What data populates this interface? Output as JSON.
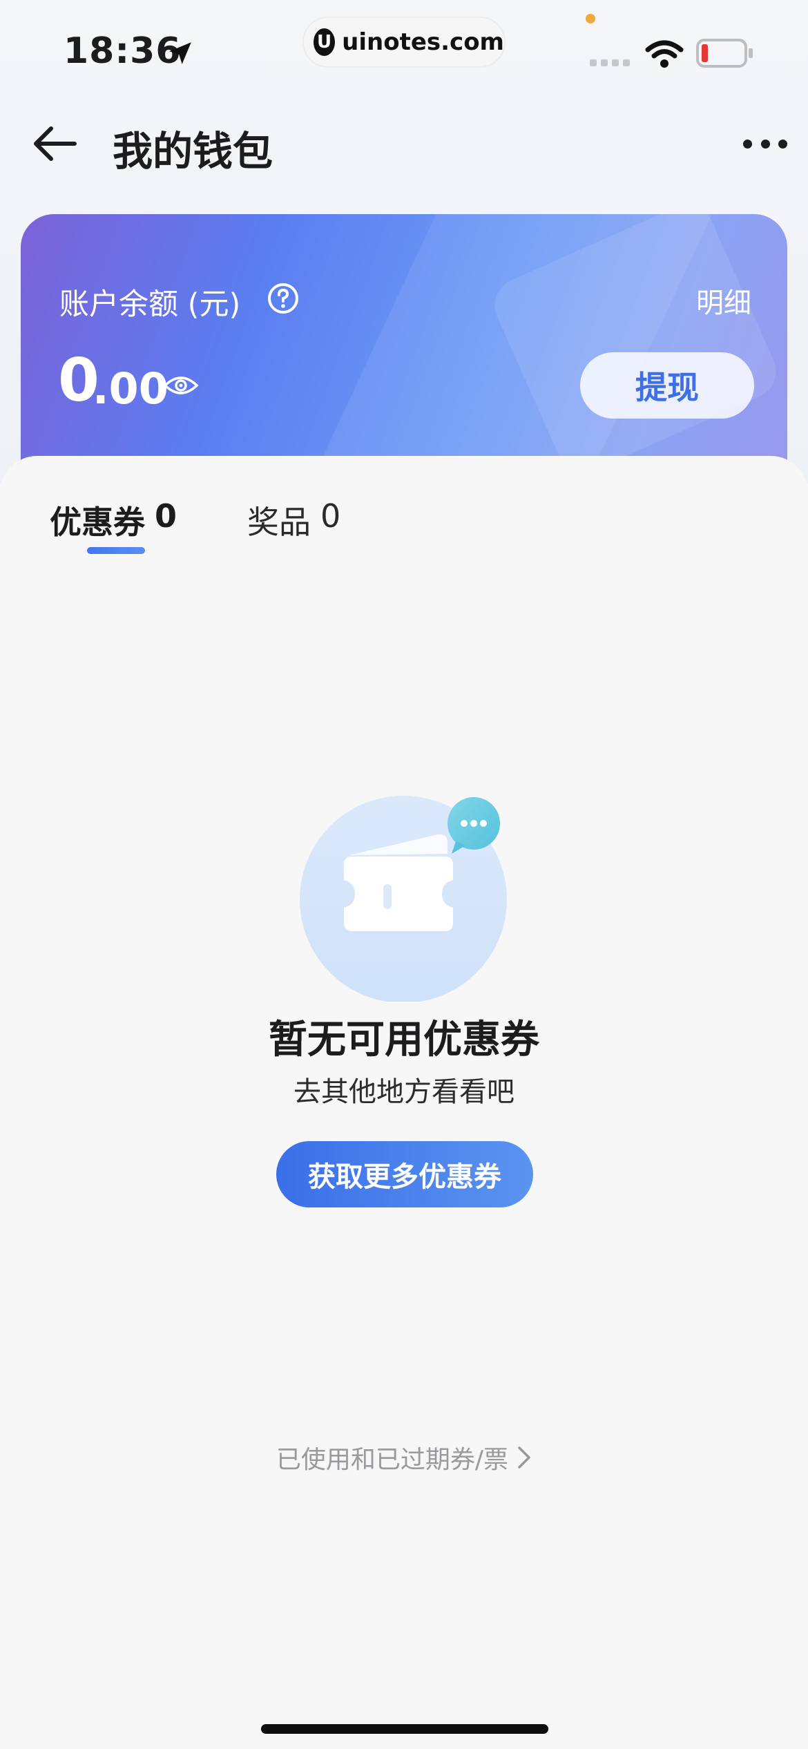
{
  "status_bar": {
    "time": "18:36",
    "site_logo_letter": "U",
    "site_text": "uinotes.com"
  },
  "nav": {
    "title": "我的钱包"
  },
  "balance": {
    "label": "账户余额 (元)",
    "detail_label": "明细",
    "amount_int": "0",
    "amount_dec": ".00",
    "withdraw_label": "提现"
  },
  "tabs": [
    {
      "label": "优惠券",
      "count": "0",
      "active": true
    },
    {
      "label": "奖品",
      "count": "0",
      "active": false
    }
  ],
  "empty_state": {
    "title": "暂无可用优惠券",
    "subtitle": "去其他地方看看吧",
    "button_label": "获取更多优惠券"
  },
  "history_link": "已使用和已过期券/票",
  "colors": {
    "accent": "#3f6fe6",
    "card_gradient_start": "#7c62d8",
    "card_gradient_end": "#9a98ee",
    "battery_low": "#e53935"
  }
}
